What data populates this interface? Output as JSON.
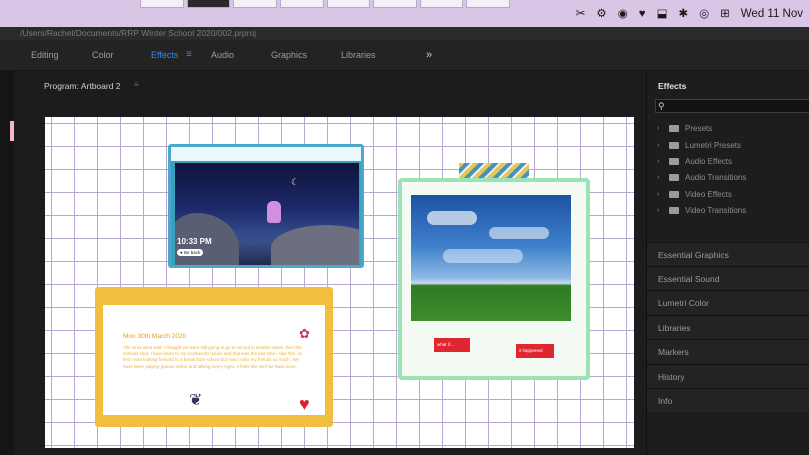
{
  "menubar": {
    "status_items": [
      "✂",
      "⚙",
      "◉",
      "♥",
      "⬓",
      "✱",
      "◎",
      "⊞"
    ],
    "clock": "Wed 11 Nov"
  },
  "file_path": "/Users/Rachel/Documents/RRP Winter School 2020/002.prproj",
  "workspace": {
    "tabs": [
      "Editing",
      "Color",
      "Effects",
      "Audio",
      "Graphics",
      "Libraries"
    ],
    "active_tab": "Effects",
    "more_label": "»"
  },
  "program": {
    "title": "Program: Artboard 2",
    "menu_glyph": "≡"
  },
  "canvas": {
    "night_card": {
      "time": "10:33 PM",
      "pill": "● Be back"
    },
    "note_card": {
      "heading": "Mon 30th March 2020",
      "body": "The virus went wild. I thought we were still going to go to school in another week, then the schools shut. I have been to my boyfriend's house and that was the last time I saw him. At first I was looking forward to a break from school but now I miss my friends so much. We have been playing games online and talking every night. It feels like we'll be back soon."
    },
    "photo_card": {
      "label_1": "what if...",
      "label_2": "it happened"
    }
  },
  "effects": {
    "title": "Effects",
    "search_placeholder": "",
    "tree": [
      "Presets",
      "Lumetri Presets",
      "Audio Effects",
      "Audio Transitions",
      "Video Effects",
      "Video Transitions"
    ],
    "panels": [
      "Essential Graphics",
      "Essential Sound",
      "Lumetri Color",
      "Libraries",
      "Markers",
      "History",
      "Info"
    ]
  },
  "colors": {
    "accent": "#2d8ceb",
    "menubar": "#d9c6e6",
    "grid_line": "#b9a9d2",
    "note_border": "#f1bf3f",
    "photo_border": "#9ce3b2",
    "night_border": "#4aa9c8",
    "red_label": "#e02631"
  },
  "icons": {
    "search": "search-icon",
    "folder": "folder-icon",
    "chevron": "chevron-right-icon"
  }
}
